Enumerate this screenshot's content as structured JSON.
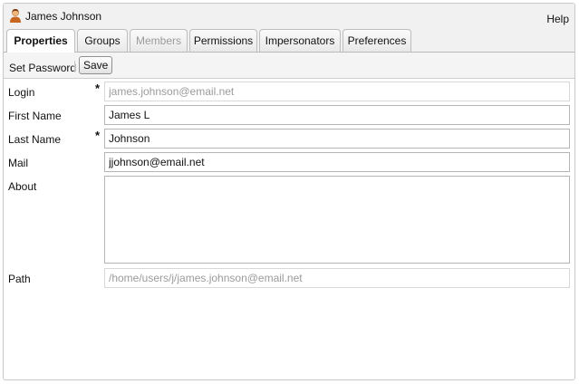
{
  "window": {
    "title": "James Johnson",
    "help_label": "Help"
  },
  "tabs": [
    {
      "label": "Properties",
      "state": "active"
    },
    {
      "label": "Groups",
      "state": "normal"
    },
    {
      "label": "Members",
      "state": "disabled"
    },
    {
      "label": "Permissions",
      "state": "normal"
    },
    {
      "label": "Impersonators",
      "state": "normal"
    },
    {
      "label": "Preferences",
      "state": "normal"
    }
  ],
  "toolbar": {
    "set_password_label": "Set Password",
    "save_label": "Save"
  },
  "form": {
    "required_marker": "*",
    "login": {
      "label": "Login",
      "value": "james.johnson@email.net",
      "required": true,
      "readonly": true
    },
    "first_name": {
      "label": "First Name",
      "value": "James L",
      "required": false,
      "readonly": false
    },
    "last_name": {
      "label": "Last Name",
      "value": "Johnson",
      "required": true,
      "readonly": false
    },
    "mail": {
      "label": "Mail",
      "value": "jjohnson@email.net",
      "required": false,
      "readonly": false
    },
    "about": {
      "label": "About",
      "value": "",
      "required": false,
      "readonly": false
    },
    "path": {
      "label": "Path",
      "value": "/home/users/j/james.johnson@email.net",
      "required": false,
      "readonly": true
    }
  },
  "icons": {
    "window_icon": "user-icon"
  }
}
